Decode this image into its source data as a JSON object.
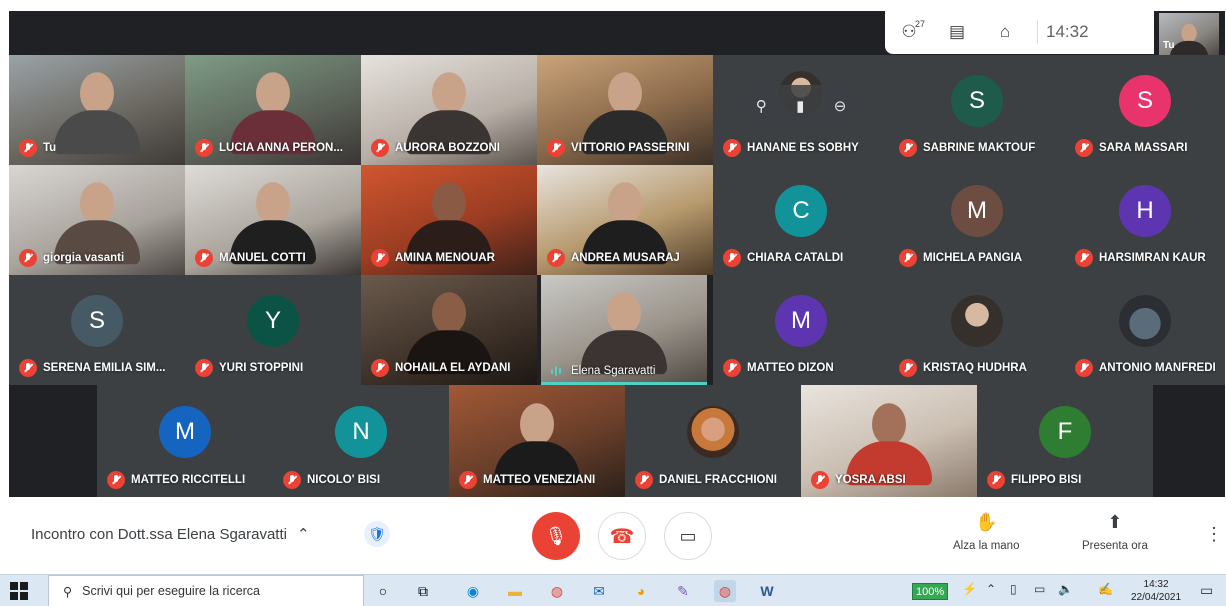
{
  "topbar": {
    "participants_count": "27",
    "clock": "14:32",
    "self_label": "Tu"
  },
  "tiles": {
    "r1": [
      "Tu",
      "LUCIA ANNA PERON...",
      "AURORA BOZZONI",
      "VITTORIO PASSERINI",
      "HANANE ES SOBHY",
      "SABRINE MAKTOUF",
      "SARA MASSARI"
    ],
    "r2": [
      "giorgia vasanti",
      "MANUEL COTTI",
      "AMINA MENOUAR",
      "ANDREA MUSARAJ",
      "CHIARA CATALDI",
      "MICHELA PANGIA",
      "HARSIMRAN KAUR"
    ],
    "r3": [
      "SERENA EMILIA SIM...",
      "YURI STOPPINI",
      "NOHAILA EL AYDANI",
      "Elena Sgaravatti",
      "MATTEO DIZON",
      "KRISTAQ HUDHRA",
      "ANTONIO MANFREDI"
    ],
    "r4": [
      "MATTEO RICCITELLI",
      "NICOLO' BISI",
      "MATTEO VENEZIANI",
      "DANIEL FRACCHIONI",
      "YOSRA ABSI",
      "FILIPPO BISI"
    ]
  },
  "avatars": {
    "sabrine": {
      "letter": "S",
      "color": "#1e5b4a"
    },
    "sara": {
      "letter": "S",
      "color": "#e8336d"
    },
    "chiara": {
      "letter": "C",
      "color": "#12939a"
    },
    "michela": {
      "letter": "M",
      "color": "#6d4c41"
    },
    "harsimran": {
      "letter": "H",
      "color": "#5e35b1"
    },
    "serena": {
      "letter": "S",
      "color": "#455a64"
    },
    "yuri": {
      "letter": "Y",
      "color": "#0b5345"
    },
    "matteo_dizon": {
      "letter": "M",
      "color": "#5e35b1"
    },
    "matteo_r": {
      "letter": "M",
      "color": "#1565c0"
    },
    "nicolo": {
      "letter": "N",
      "color": "#12939a"
    },
    "filippo": {
      "letter": "F",
      "color": "#2e7d32"
    }
  },
  "meeting": {
    "title": "Incontro con Dott.ssa Elena Sgaravatti",
    "raise_hand": "Alza la mano",
    "present_now": "Presenta ora"
  },
  "taskbar": {
    "search_placeholder": "Scrivi qui per eseguire la ricerca",
    "battery": "100%",
    "time": "14:32",
    "date": "22/04/2021"
  }
}
